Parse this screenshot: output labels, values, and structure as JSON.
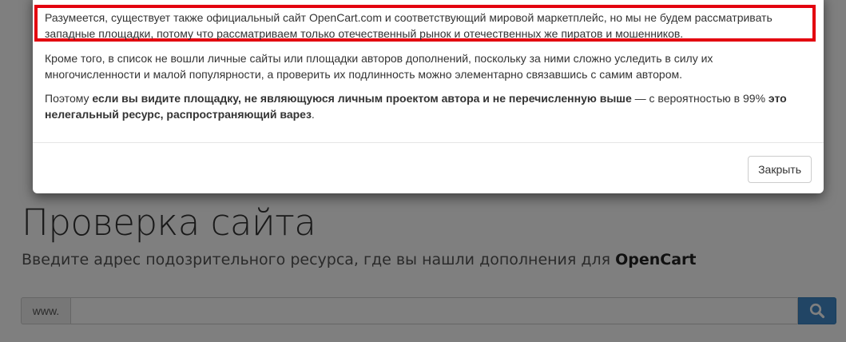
{
  "page": {
    "title": "Проверка сайта",
    "subtitle_prefix": "Введите адрес подозрительного ресурса, где вы нашли дополнения для ",
    "subtitle_bold": "OpenCart",
    "search": {
      "addon_label": "www.",
      "value": "",
      "button_icon": "search-icon"
    }
  },
  "modal": {
    "paragraph1": "Разумеется, существует также официальный сайт OpenCart.com и соответствующий мировой маркетплейс, но мы не будем рассматривать западные площадки, потому что рассматриваем только отечественный рынок и отечественных же пиратов и мошенников.",
    "paragraph2": "Кроме того, в список не вошли личные сайты или площадки авторов дополнений, поскольку за ними сложно уследить в силу их многочисленности и малой популярности, а проверить их подлинность можно элементарно связавшись с самим автором.",
    "paragraph3": {
      "t1": "Поэтому ",
      "b1": "если вы видите площадку, не являющуюся личным проектом автора и не перечисленную выше",
      "t2": " — с вероятностью в 99% ",
      "b2": "это нелегальный ресурс, распространяющий варез",
      "t3": "."
    },
    "close_label": "Закрыть"
  },
  "colors": {
    "highlight": "#e3000f",
    "search_button": "#428bca"
  }
}
